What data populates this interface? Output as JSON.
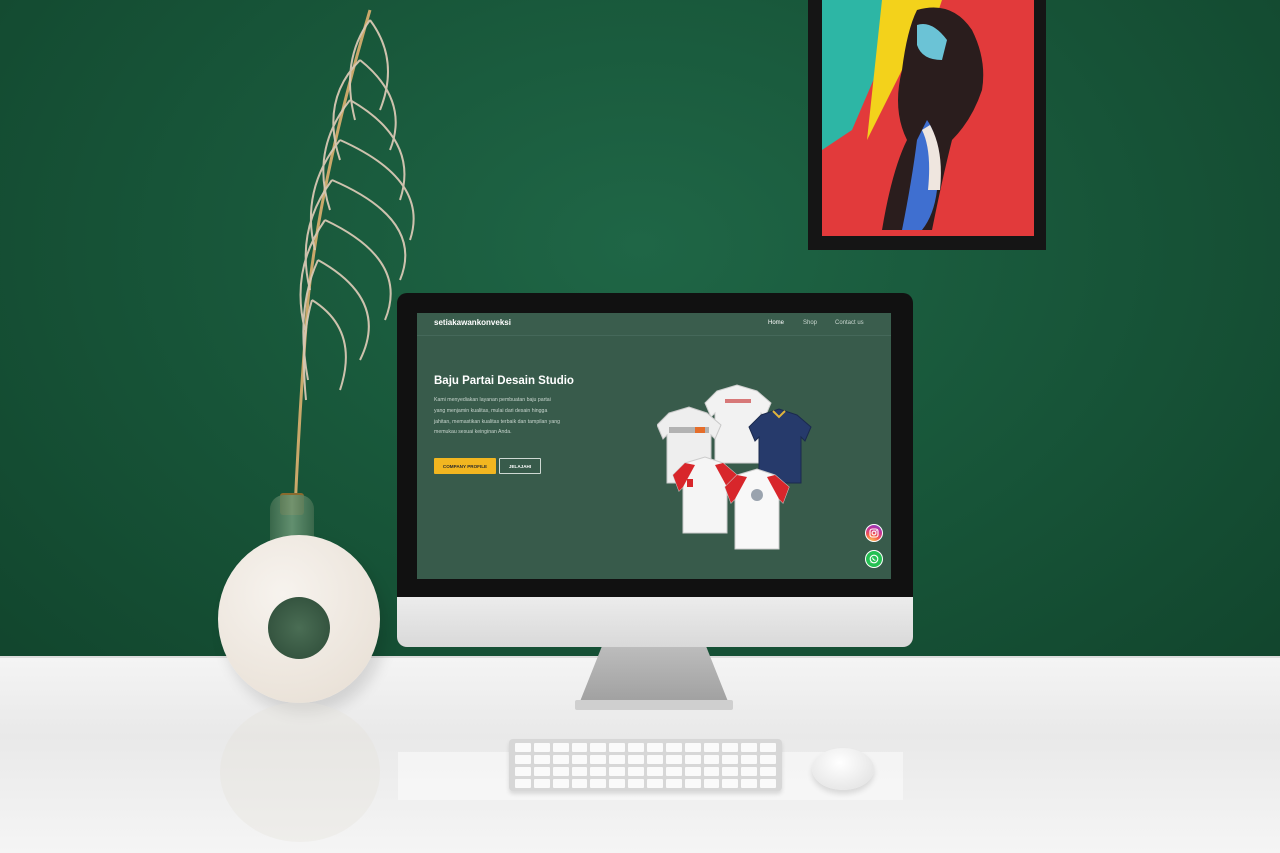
{
  "site": {
    "brand": "setiakawankonveksi",
    "nav": [
      {
        "label": "Home",
        "active": true
      },
      {
        "label": "Shop",
        "active": false
      },
      {
        "label": "Contact us",
        "active": false
      }
    ],
    "hero": {
      "title": "Baju Partai Desain Studio",
      "description": "Kami menyediakan layanan pembuatan baju partai yang menjamin kualitas, mulai dari desain hingga jahitan, memastikan kualitas terbaik dan tampilan yang memukau sesuai keinginan Anda.",
      "primary_button": "COMPANY PROFILE",
      "secondary_button": "JELAJAHI"
    },
    "floating_buttons": [
      "instagram-icon",
      "whatsapp-icon"
    ]
  },
  "colors": {
    "wall": "#18573a",
    "screen_background": "#385b4b",
    "primary_button": "#f2b620",
    "whatsapp": "#25c053"
  }
}
